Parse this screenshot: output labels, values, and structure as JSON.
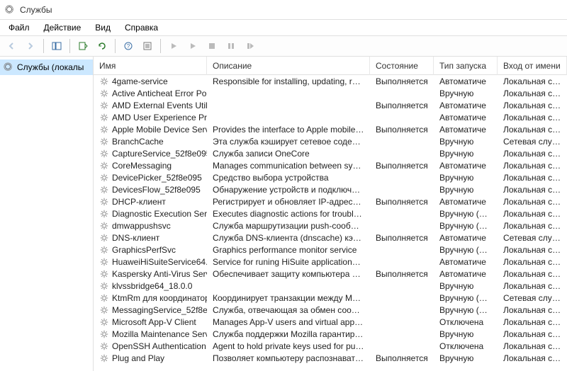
{
  "window": {
    "title": "Службы"
  },
  "menu": {
    "file": "Файл",
    "action": "Действие",
    "view": "Вид",
    "help": "Справка"
  },
  "tree": {
    "root_label": "Службы (локалы"
  },
  "columns": {
    "name": "Имя",
    "description": "Описание",
    "state": "Состояние",
    "startup": "Тип запуска",
    "logon": "Вход от имени"
  },
  "services": [
    {
      "name": "4game-service",
      "desc": "Responsible for installing, updating, repairin...",
      "state": "Выполняется",
      "startup": "Автоматиче",
      "logon": "Локальная сис..."
    },
    {
      "name": "Active Anticheat Error Port ...",
      "desc": "",
      "state": "",
      "startup": "Вручную",
      "logon": "Локальная сис..."
    },
    {
      "name": "AMD External Events Utility",
      "desc": "",
      "state": "Выполняется",
      "startup": "Автоматиче",
      "logon": "Локальная сис..."
    },
    {
      "name": "AMD User Experience Progr...",
      "desc": "",
      "state": "",
      "startup": "Автоматиче",
      "logon": "Локальная сис..."
    },
    {
      "name": "Apple Mobile Device Service",
      "desc": "Provides the interface to Apple mobile devic",
      "state": "Выполняется",
      "startup": "Автоматиче",
      "logon": "Локальная сис..."
    },
    {
      "name": "BranchCache",
      "desc": "Эта служба кэширует сетевое содержимо...",
      "state": "",
      "startup": "Вручную",
      "logon": "Сетевая служба"
    },
    {
      "name": "CaptureService_52f8e095",
      "desc": "Служба записи OneCore",
      "state": "",
      "startup": "Вручную",
      "logon": "Локальная сис..."
    },
    {
      "name": "CoreMessaging",
      "desc": "Manages communication between system c...",
      "state": "Выполняется",
      "startup": "Автоматиче",
      "logon": "Локальная слу"
    },
    {
      "name": "DevicePicker_52f8e095",
      "desc": "Средство выбора устройства",
      "state": "",
      "startup": "Вручную",
      "logon": "Локальная сис..."
    },
    {
      "name": "DevicesFlow_52f8e095",
      "desc": "Обнаружение устройств и подключение",
      "state": "",
      "startup": "Вручную",
      "logon": "Локальная сис..."
    },
    {
      "name": "DHCP-клиент",
      "desc": "Регистрирует и обновляет IP-адреса и DNS...",
      "state": "Выполняется",
      "startup": "Автоматиче",
      "logon": "Локальная слу"
    },
    {
      "name": "Diagnostic Execution Service",
      "desc": "Executes diagnostic actions for troubleshooti...",
      "state": "",
      "startup": "Вручную (ак...",
      "logon": "Локальная сис..."
    },
    {
      "name": "dmwappushsvc",
      "desc": "Служба маршрутизации push-сообщений...",
      "state": "",
      "startup": "Вручную (ак...",
      "logon": "Локальная сис..."
    },
    {
      "name": "DNS-клиент",
      "desc": "Служба DNS-клиента (dnscache) кэширует...",
      "state": "Выполняется",
      "startup": "Автоматиче",
      "logon": "Сетевая служба"
    },
    {
      "name": "GraphicsPerfSvc",
      "desc": "Graphics performance monitor service",
      "state": "",
      "startup": "Вручную (ак...",
      "logon": "Локальная сис..."
    },
    {
      "name": "HuaweiHiSuiteService64.exe",
      "desc": "Service for runing HiSuite applications autor",
      "state": "",
      "startup": "Автоматиче",
      "logon": "Локальная сис..."
    },
    {
      "name": "Kaspersky Anti-Virus Servic...",
      "desc": "Обеспечивает защиту компьютера от вир...",
      "state": "Выполняется",
      "startup": "Автоматиче",
      "logon": "Локальная сис..."
    },
    {
      "name": "klvssbridge64_18.0.0",
      "desc": "",
      "state": "",
      "startup": "Вручную",
      "logon": "Локальная сис..."
    },
    {
      "name": "KtmRm для координатора ...",
      "desc": "Координирует транзакции между MS DTC ...",
      "state": "",
      "startup": "Вручную (ак...",
      "logon": "Сетевая служба"
    },
    {
      "name": "MessagingService_52f8e095",
      "desc": "Служба, отвечающая за обмен сообщени...",
      "state": "",
      "startup": "Вручную (ак...",
      "logon": "Локальная сис..."
    },
    {
      "name": "Microsoft App-V Client",
      "desc": "Manages App-V users and virtual applications",
      "state": "",
      "startup": "Отключена",
      "logon": "Локальная сис..."
    },
    {
      "name": "Mozilla Maintenance Service",
      "desc": "Служба поддержки Mozilla гарантирует, чт...",
      "state": "",
      "startup": "Вручную",
      "logon": "Локальная сис..."
    },
    {
      "name": "OpenSSH Authentication A...",
      "desc": "Agent to hold private keys used for public ke...",
      "state": "",
      "startup": "Отключена",
      "logon": "Локальная сис..."
    },
    {
      "name": "Plug and Play",
      "desc": "Позволяет компьютеру распознавать ...",
      "state": "Выполняется",
      "startup": "Вручную",
      "logon": "Локальная сис..."
    }
  ]
}
